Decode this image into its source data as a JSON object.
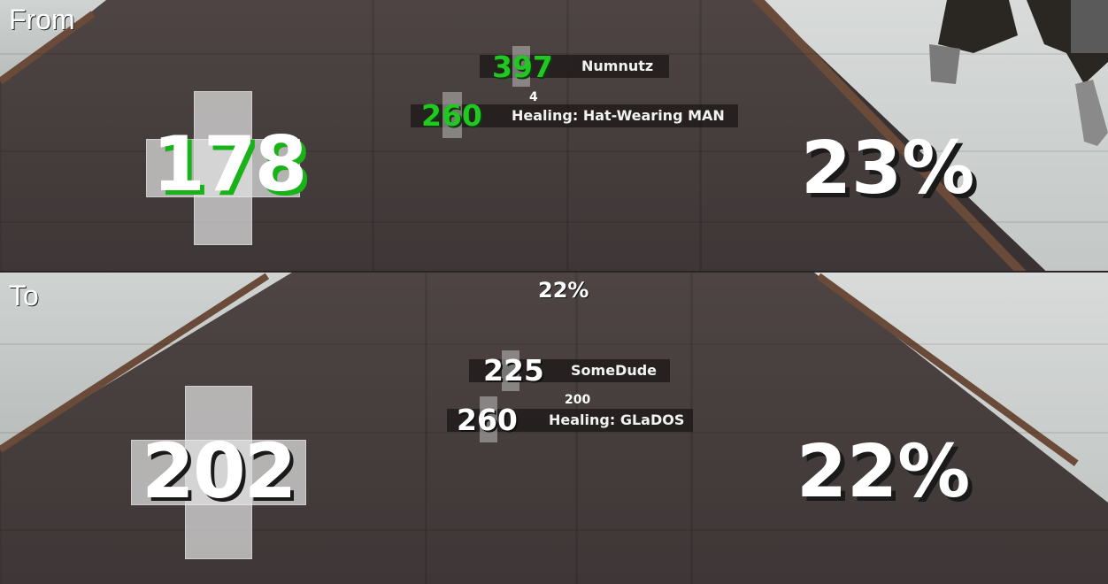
{
  "from": {
    "label": "From",
    "health": "178",
    "uber": "23%",
    "targets": [
      {
        "hp": "397",
        "name": "Numnutz"
      },
      {
        "hp": "260",
        "name": "Healing: Hat-Wearing MAN"
      }
    ],
    "small_num": "4"
  },
  "to": {
    "label": "To",
    "health": "202",
    "uber": "22%",
    "charge_top": "22%",
    "targets": [
      {
        "hp": "225",
        "name": "SomeDude"
      },
      {
        "hp": "260",
        "name": "Healing: GLaDOS"
      }
    ],
    "small_num": "200"
  },
  "colors": {
    "buff_green": "#19b319",
    "text_white": "#ffffff",
    "floor": "#4a4040"
  }
}
